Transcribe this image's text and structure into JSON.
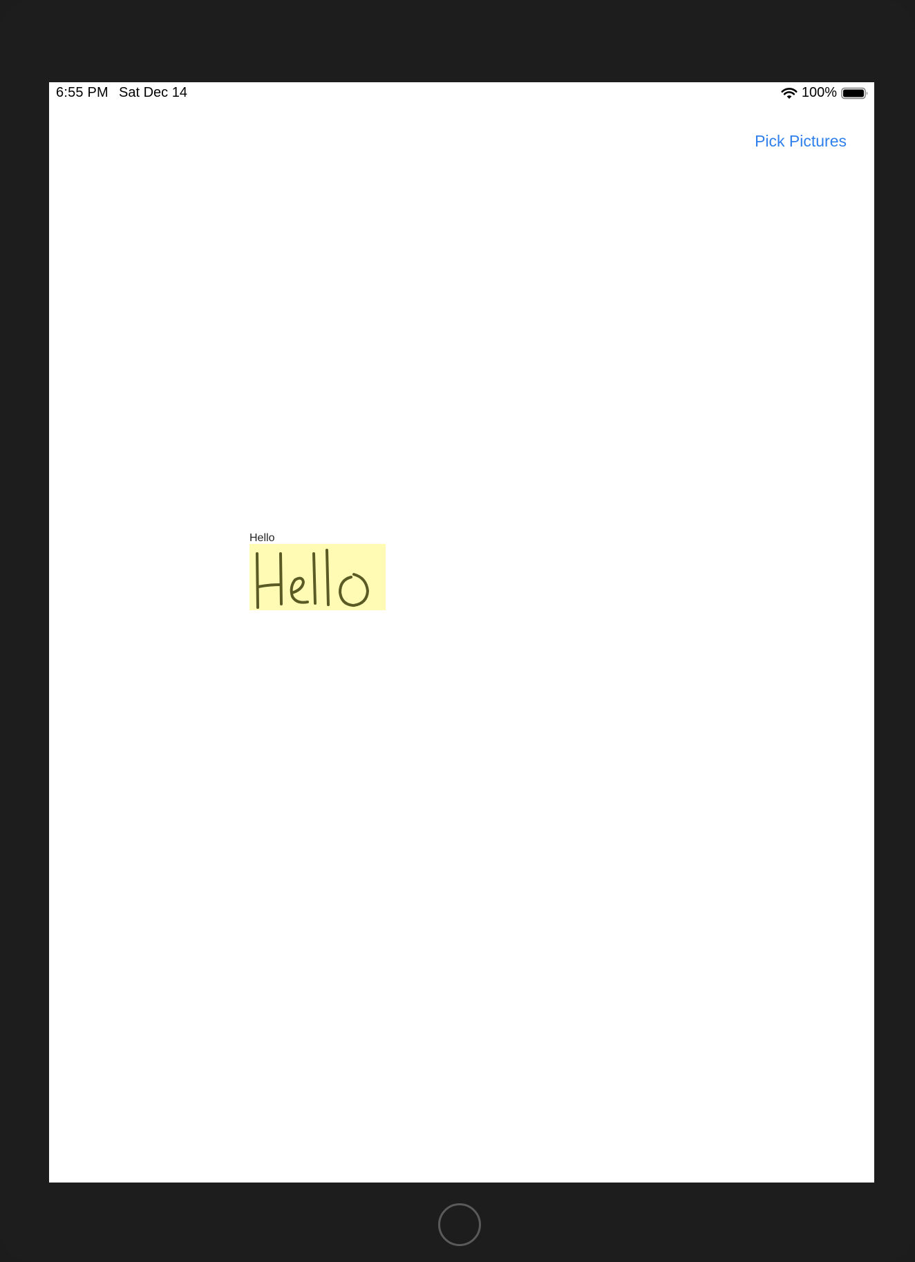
{
  "status_bar": {
    "time": "6:55 PM",
    "date": "Sat Dec 14",
    "battery_percent": "100%",
    "battery_level": 1.0,
    "icons": [
      "wifi-icon",
      "battery-icon"
    ]
  },
  "navigation": {
    "pick_button_label": "Pick Pictures",
    "accent_color": "#2f80ed"
  },
  "content": {
    "items": [
      {
        "label": "Hello",
        "image_text": "Hello",
        "image_background": "#fffbb5"
      }
    ]
  },
  "device": {
    "home_button": "home-button"
  }
}
